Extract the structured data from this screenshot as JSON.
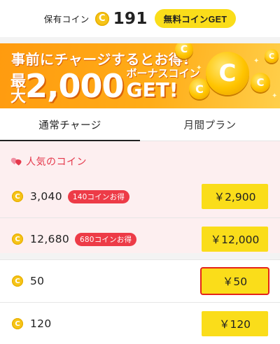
{
  "header": {
    "owned_label": "保有コイン",
    "coin_glyph": "C",
    "coin_count": "191",
    "free_get_label": "無料コインGET"
  },
  "banner": {
    "line1": "事前にチャージするとお得!",
    "max_label": "最大",
    "amount": "2,000",
    "bonus_label": "ボーナスコイン",
    "get_label": "GET!",
    "coin_glyph": "C"
  },
  "tabs": [
    {
      "label": "通常チャージ",
      "active": true
    },
    {
      "label": "月間プラン",
      "active": false
    }
  ],
  "popular": {
    "title": "人気のコイン",
    "items": [
      {
        "amount": "3,040",
        "badge": "140コインお得",
        "price": "￥2,900"
      },
      {
        "amount": "12,680",
        "badge": "680コインお得",
        "price": "￥12,000"
      }
    ]
  },
  "items": [
    {
      "amount": "50",
      "price": "￥50"
    },
    {
      "amount": "120",
      "price": "￥120"
    }
  ],
  "colors": {
    "accent_yellow": "#fadd1a",
    "coin_gold": "#f6c418",
    "badge_red": "#ed3b47",
    "popular_bg": "#fdeff0",
    "highlight_red": "#e42419"
  }
}
